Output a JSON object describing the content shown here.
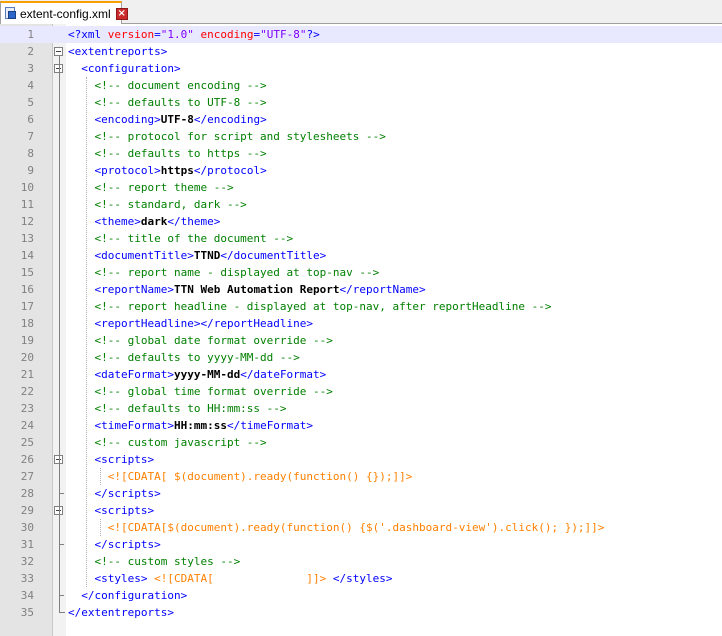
{
  "tab": {
    "filename": "extent-config.xml",
    "close_label": "×"
  },
  "icons": {
    "file": "notepad-file-icon",
    "close": "close-tab-icon",
    "fold_open": "fold-minus-icon"
  },
  "colors": {
    "tag": "#0000ff",
    "attribute": "#ff0000",
    "attr_value": "#8000ff",
    "comment": "#008000",
    "cdata": "#ff8000",
    "current_line": "#e8e8ff"
  },
  "lines": [
    [
      [
        "t-blue",
        "<?xml "
      ],
      [
        "t-red",
        "version"
      ],
      [
        "t-blue",
        "="
      ],
      [
        "t-purple",
        "\"1.0\""
      ],
      [
        "t-blue",
        " "
      ],
      [
        "t-red",
        "encoding"
      ],
      [
        "t-blue",
        "="
      ],
      [
        "t-purple",
        "\"UTF-8\""
      ],
      [
        "t-blue",
        "?>"
      ]
    ],
    [
      [
        "t-blue",
        "<extentreports>"
      ]
    ],
    [
      [
        "t-blue",
        "  <configuration>"
      ]
    ],
    [
      [
        "t-green",
        "    <!-- document encoding -->"
      ]
    ],
    [
      [
        "t-green",
        "    <!-- defaults to UTF-8 -->"
      ]
    ],
    [
      [
        "t-blue",
        "    <encoding>"
      ],
      [
        "t-text",
        "UTF-8"
      ],
      [
        "t-blue",
        "</encoding>"
      ]
    ],
    [
      [
        "t-green",
        "    <!-- protocol for script and stylesheets -->"
      ]
    ],
    [
      [
        "t-green",
        "    <!-- defaults to https -->"
      ]
    ],
    [
      [
        "t-blue",
        "    <protocol>"
      ],
      [
        "t-text",
        "https"
      ],
      [
        "t-blue",
        "</protocol>"
      ]
    ],
    [
      [
        "t-green",
        "    <!-- report theme -->"
      ]
    ],
    [
      [
        "t-green",
        "    <!-- standard, dark -->"
      ]
    ],
    [
      [
        "t-blue",
        "    <theme>"
      ],
      [
        "t-text",
        "dark"
      ],
      [
        "t-blue",
        "</theme>"
      ]
    ],
    [
      [
        "t-green",
        "    <!-- title of the document -->"
      ]
    ],
    [
      [
        "t-blue",
        "    <documentTitle>"
      ],
      [
        "t-text",
        "TTND"
      ],
      [
        "t-blue",
        "</documentTitle>"
      ]
    ],
    [
      [
        "t-green",
        "    <!-- report name - displayed at top-nav -->"
      ]
    ],
    [
      [
        "t-blue",
        "    <reportName>"
      ],
      [
        "t-text",
        "TTN Web Automation Report"
      ],
      [
        "t-blue",
        "</reportName>"
      ]
    ],
    [
      [
        "t-green",
        "    <!-- report headline - displayed at top-nav, after reportHeadline -->"
      ]
    ],
    [
      [
        "t-blue",
        "    <reportHeadline></reportHeadline>"
      ]
    ],
    [
      [
        "t-green",
        "    <!-- global date format override -->"
      ]
    ],
    [
      [
        "t-green",
        "    <!-- defaults to yyyy-MM-dd -->"
      ]
    ],
    [
      [
        "t-blue",
        "    <dateFormat>"
      ],
      [
        "t-text",
        "yyyy-MM-dd"
      ],
      [
        "t-blue",
        "</dateFormat>"
      ]
    ],
    [
      [
        "t-green",
        "    <!-- global time format override -->"
      ]
    ],
    [
      [
        "t-green",
        "    <!-- defaults to HH:mm:ss -->"
      ]
    ],
    [
      [
        "t-blue",
        "    <timeFormat>"
      ],
      [
        "t-text",
        "HH:mm:ss"
      ],
      [
        "t-blue",
        "</timeFormat>"
      ]
    ],
    [
      [
        "t-green",
        "    <!-- custom javascript -->"
      ]
    ],
    [
      [
        "t-blue",
        "    <scripts>"
      ]
    ],
    [
      [
        "t-orange",
        "      <![CDATA[ $(document).ready(function() {});]]>"
      ]
    ],
    [
      [
        "t-blue",
        "    </scripts>"
      ]
    ],
    [
      [
        "t-blue",
        "    <scripts>"
      ]
    ],
    [
      [
        "t-orange",
        "      <![CDATA[$(document).ready(function() {$('.dashboard-view').click(); });]]>"
      ]
    ],
    [
      [
        "t-blue",
        "    </scripts>"
      ]
    ],
    [
      [
        "t-green",
        "    <!-- custom styles -->"
      ]
    ],
    [
      [
        "t-blue",
        "    <styles> "
      ],
      [
        "t-orange",
        "<![CDATA[              ]]>"
      ],
      [
        "t-blue",
        " </styles>"
      ]
    ],
    [
      [
        "t-blue",
        "  </configuration>"
      ]
    ],
    [
      [
        "t-blue",
        "</extentreports>"
      ]
    ]
  ],
  "line_numbers": [
    "1",
    "2",
    "3",
    "4",
    "5",
    "6",
    "7",
    "8",
    "9",
    "10",
    "11",
    "12",
    "13",
    "14",
    "15",
    "16",
    "17",
    "18",
    "19",
    "20",
    "21",
    "22",
    "23",
    "24",
    "25",
    "26",
    "27",
    "28",
    "29",
    "30",
    "31",
    "32",
    "33",
    "34",
    "35"
  ]
}
